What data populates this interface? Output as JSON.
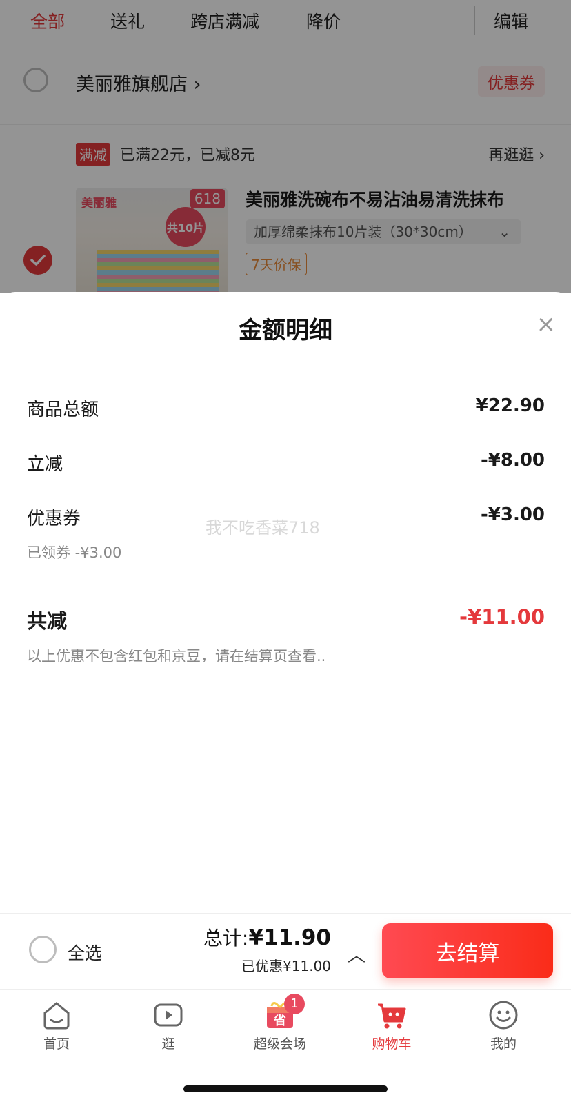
{
  "tabs": {
    "all": "全部",
    "gift": "送礼",
    "cross_store": "跨店满减",
    "price_drop": "降价",
    "edit": "编辑"
  },
  "store": {
    "name": "美丽雅旗舰店",
    "arrow": "›",
    "coupon": "优惠券"
  },
  "promo": {
    "tag": "满减",
    "text": "已满22元，已减8元",
    "more": "再逛逛 ›"
  },
  "product": {
    "title": "美丽雅洗碗布不易沾油易清洗抹布",
    "sku": "加厚绵柔抹布10片装（30*30cm）",
    "guarantee": "7天价保",
    "badge_618": "618",
    "badge_count": "共10片",
    "brand_mark": "美丽雅"
  },
  "sheet": {
    "title": "金额明细",
    "close": "×",
    "rows": {
      "goods_total_label": "商品总额",
      "goods_total_value": "¥22.90",
      "instant_label": "立减",
      "instant_value": "-¥8.00",
      "coupon_label": "优惠券",
      "coupon_value": "-¥3.00",
      "coupon_sub": "已领券 -¥3.00",
      "total_cut_label": "共减",
      "total_cut_value": "-¥11.00",
      "note": "以上优惠不包含红包和京豆，请在结算页查看.."
    },
    "watermark": "我不吃香菜718"
  },
  "checkout": {
    "select_all": "全选",
    "total_label": "总计:",
    "total_value": "¥11.90",
    "saved": "已优惠¥11.00",
    "expand": "︿",
    "pay": "去结算"
  },
  "tabbar": {
    "home": "首页",
    "browse": "逛",
    "super": "超级会场",
    "super_badge": "1",
    "cart": "购物车",
    "mine": "我的"
  },
  "colors": {
    "accent": "#e4393c",
    "pay_gradient_start": "#ff4a52",
    "pay_gradient_end": "#fa2c19"
  }
}
